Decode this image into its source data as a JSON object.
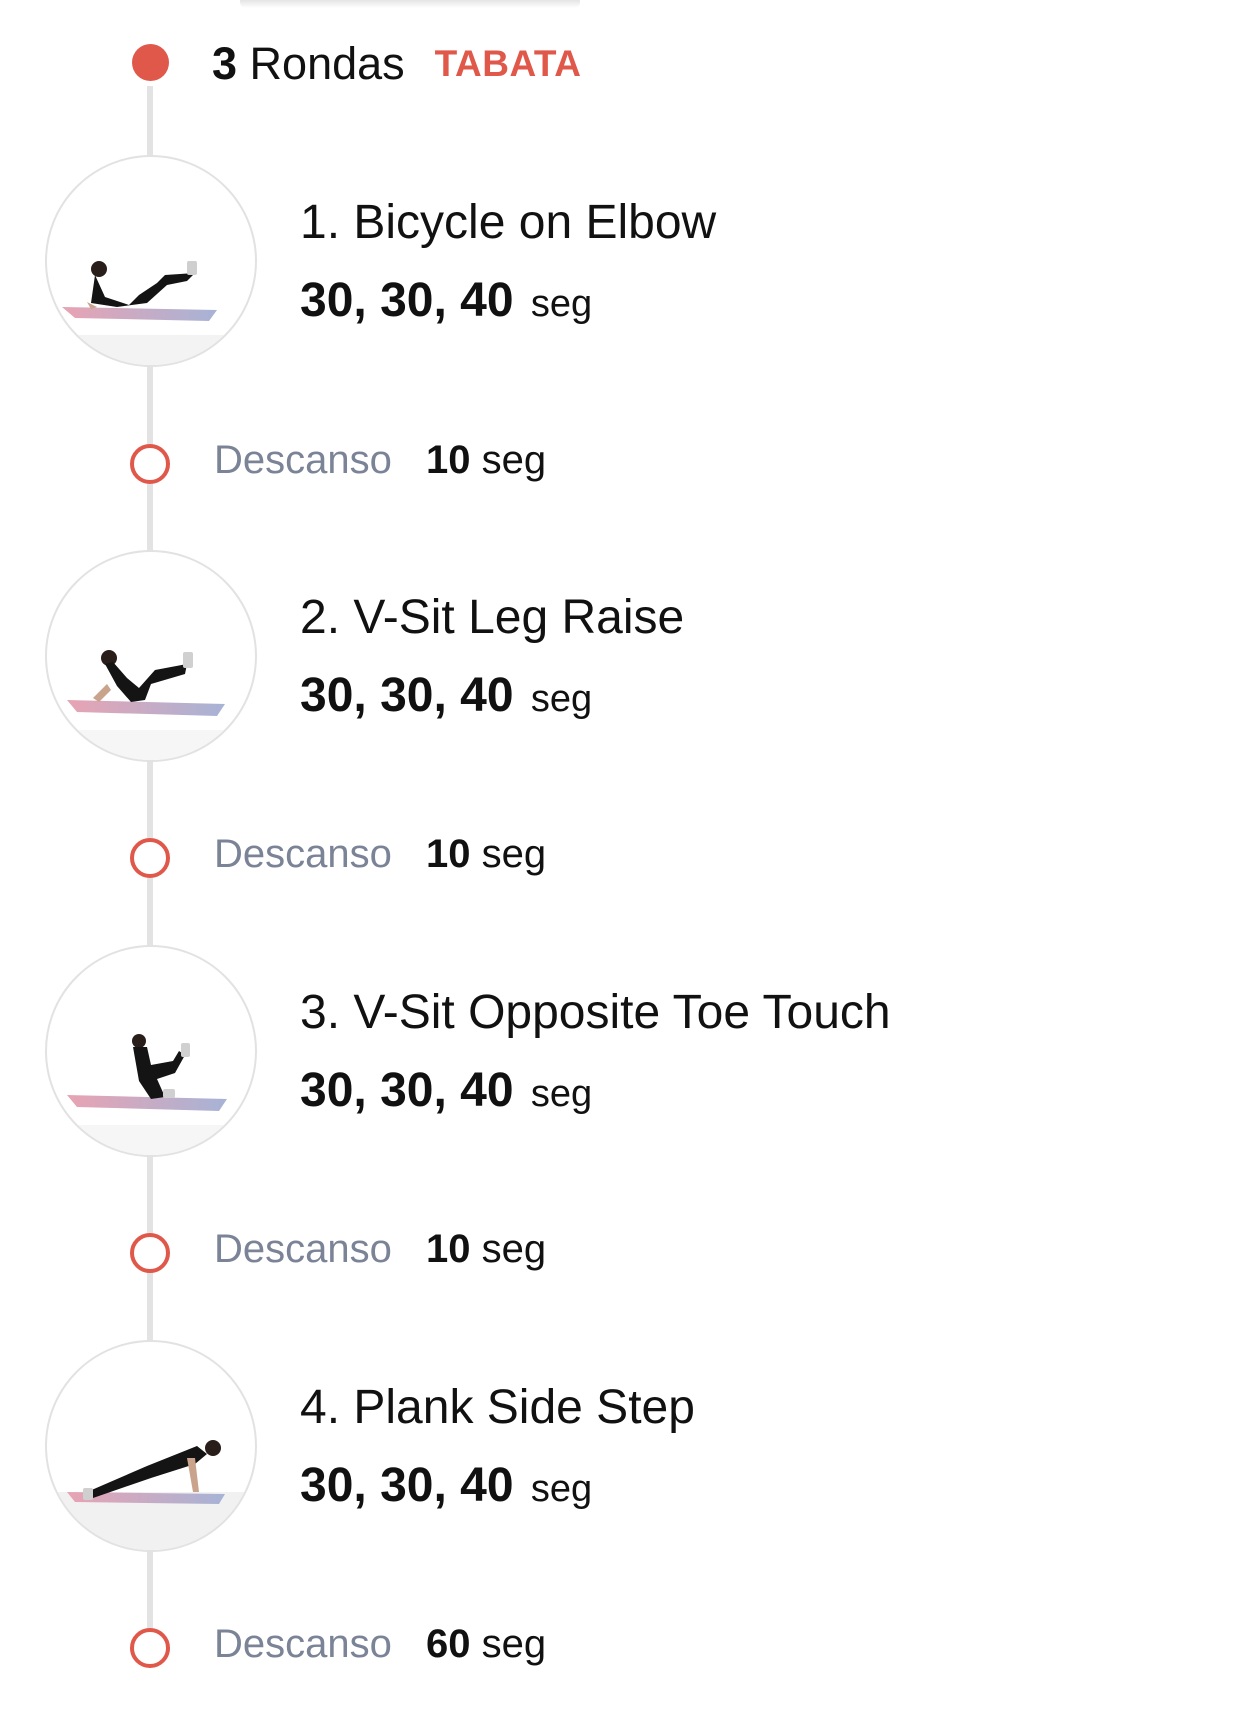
{
  "header": {
    "rounds_count": "3",
    "rounds_label": "Rondas",
    "round_type": "TABATA"
  },
  "colors": {
    "accent": "#e0584a",
    "rest_label": "#7b8397",
    "timeline": "#e3e3e3"
  },
  "exercises": [
    {
      "name": "1. Bicycle on Elbow",
      "durations": "30, 30, 40",
      "unit": "seg",
      "thumbnail": "bicycle-on-elbow-image"
    },
    {
      "name": "2. V-Sit Leg Raise",
      "durations": "30, 30, 40",
      "unit": "seg",
      "thumbnail": "v-sit-leg-raise-image"
    },
    {
      "name": "3. V-Sit Opposite Toe Touch",
      "durations": "30, 30, 40",
      "unit": "seg",
      "thumbnail": "v-sit-opposite-toe-touch-image"
    },
    {
      "name": "4. Plank Side Step",
      "durations": "30, 30, 40",
      "unit": "seg",
      "thumbnail": "plank-side-step-image"
    }
  ],
  "rests": [
    {
      "label": "Descanso",
      "value": "10",
      "unit": "seg"
    },
    {
      "label": "Descanso",
      "value": "10",
      "unit": "seg"
    },
    {
      "label": "Descanso",
      "value": "10",
      "unit": "seg"
    },
    {
      "label": "Descanso",
      "value": "60",
      "unit": "seg"
    }
  ]
}
